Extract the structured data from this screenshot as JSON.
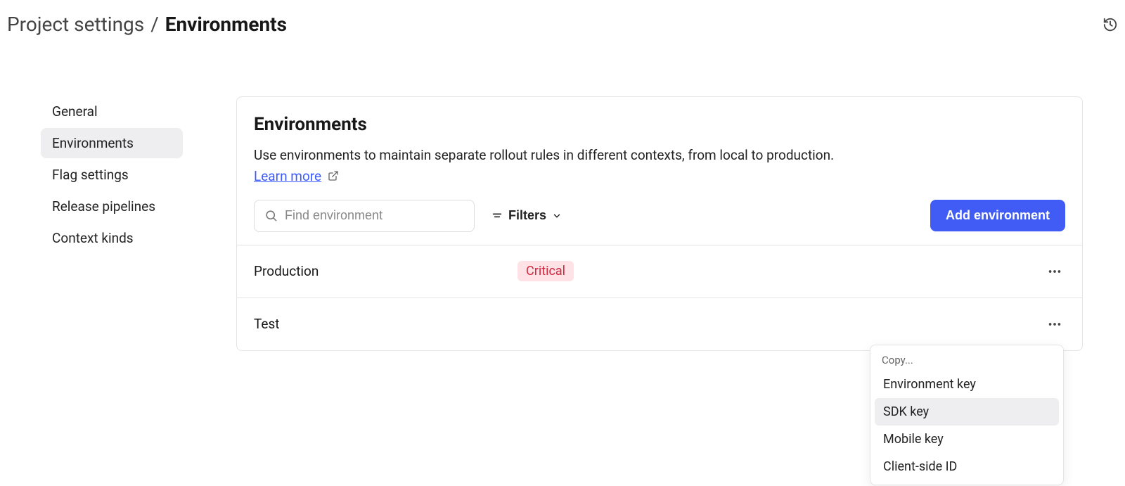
{
  "breadcrumb": {
    "parent": "Project settings",
    "current": "Environments"
  },
  "sidebar": {
    "items": [
      {
        "label": "General"
      },
      {
        "label": "Environments"
      },
      {
        "label": "Flag settings"
      },
      {
        "label": "Release pipelines"
      },
      {
        "label": "Context kinds"
      }
    ],
    "active_index": 1
  },
  "panel": {
    "title": "Environments",
    "description": "Use environments to maintain separate rollout rules in different contexts, from local to production. ",
    "learn_more": "Learn more",
    "search_placeholder": "Find environment",
    "filters_label": "Filters",
    "add_button": "Add environment"
  },
  "environments": [
    {
      "name": "Production",
      "badge": "Critical"
    },
    {
      "name": "Test",
      "badge": null
    }
  ],
  "dropdown": {
    "heading": "Copy...",
    "items": [
      {
        "label": "Environment key"
      },
      {
        "label": "SDK key"
      },
      {
        "label": "Mobile key"
      },
      {
        "label": "Client-side ID"
      }
    ],
    "highlight_index": 1
  }
}
